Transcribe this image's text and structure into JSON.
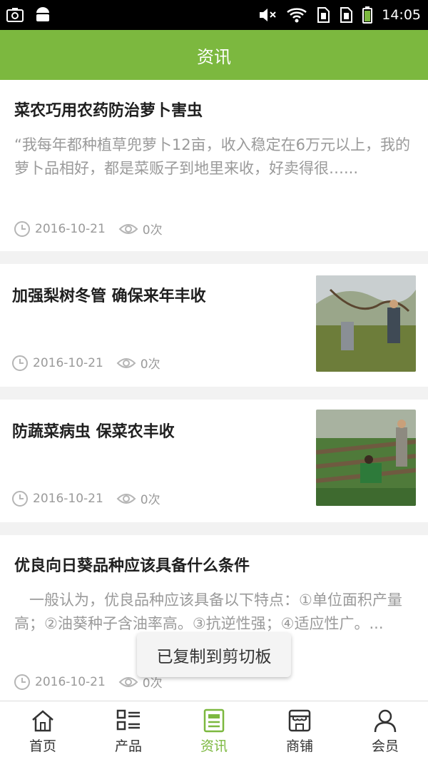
{
  "status_bar": {
    "time": "14:05"
  },
  "header": {
    "title": "资讯"
  },
  "articles": [
    {
      "title": "菜农巧用农药防治萝卜害虫",
      "summary": "“我每年都种植草兜萝卜12亩，收入稳定在6万元以上，我的萝卜品相好，都是菜贩子到地里来收，好卖得很…...",
      "date": "2016-10-21",
      "views": "0次"
    },
    {
      "title": "加强梨树冬管 确保来年丰收",
      "date": "2016-10-21",
      "views": "0次"
    },
    {
      "title": "防蔬菜病虫 保菜农丰收",
      "date": "2016-10-21",
      "views": "0次"
    },
    {
      "title": "优良向日葵品种应该具备什么条件",
      "summary": "　一般认为，优良品种应该具备以下特点：①单位面积产量高；②油葵种子含油率高。③抗逆性强；④适应性广。...",
      "date": "2016-10-21",
      "views": "0次"
    }
  ],
  "toast": {
    "text": "已复制到剪切板"
  },
  "tabs": [
    {
      "label": "首页",
      "icon": "home-icon"
    },
    {
      "label": "产品",
      "icon": "product-list-icon"
    },
    {
      "label": "资讯",
      "icon": "news-icon",
      "active": true
    },
    {
      "label": "商铺",
      "icon": "shop-icon"
    },
    {
      "label": "会员",
      "icon": "member-icon"
    }
  ],
  "colors": {
    "accent": "#7cb83f",
    "text_muted": "#9a9a9a"
  }
}
